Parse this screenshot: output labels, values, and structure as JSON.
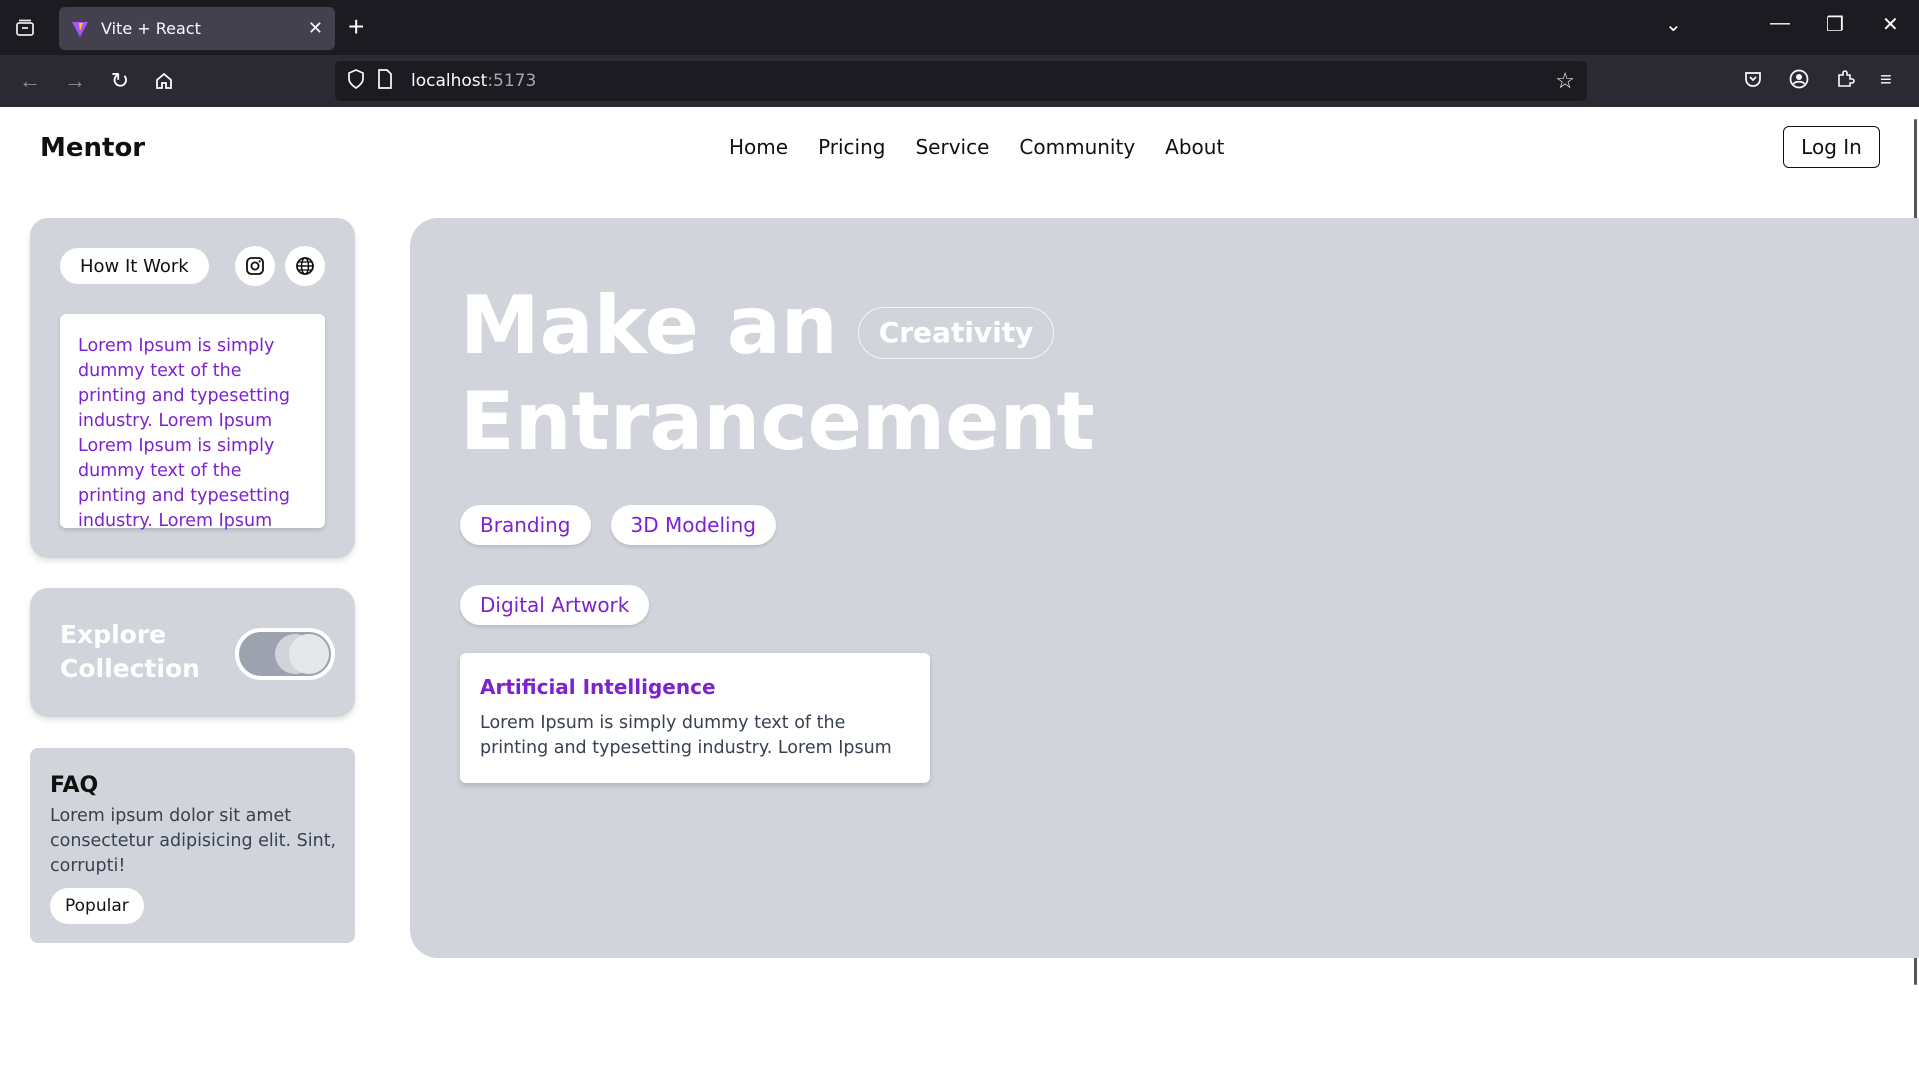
{
  "browser": {
    "tab_title": "Vite + React",
    "url_host": "localhost",
    "url_port": ":5173"
  },
  "header": {
    "logo": "Mentor",
    "nav": [
      "Home",
      "Pricing",
      "Service",
      "Community",
      "About"
    ],
    "login": "Log In"
  },
  "how": {
    "pill": "How It Work",
    "text": "Lorem Ipsum is simply dummy text of the printing and typesetting industry. Lorem Ipsum Lorem Ipsum is simply dummy text of the printing and typesetting industry. Lorem Ipsum"
  },
  "explore": {
    "label": "Explore Collection"
  },
  "faq": {
    "title": "FAQ",
    "text": "Lorem ipsum dolor sit amet consectetur adipisicing elit. Sint, corrupti!",
    "pill": "Popular"
  },
  "hero": {
    "line1": "Make an",
    "badge": "Creativity",
    "line2": "Entrancement",
    "tags_row1": [
      "Branding",
      "3D Modeling"
    ],
    "tags_row2": [
      "Digital Artwork"
    ],
    "card_title": "Artificial Intelligence",
    "card_text": "Lorem Ipsum is simply dummy text of the printing and typesetting industry. Lorem Ipsum"
  },
  "colors": {
    "accent": "#7e22ce",
    "card_bg": "#d1d5db"
  }
}
